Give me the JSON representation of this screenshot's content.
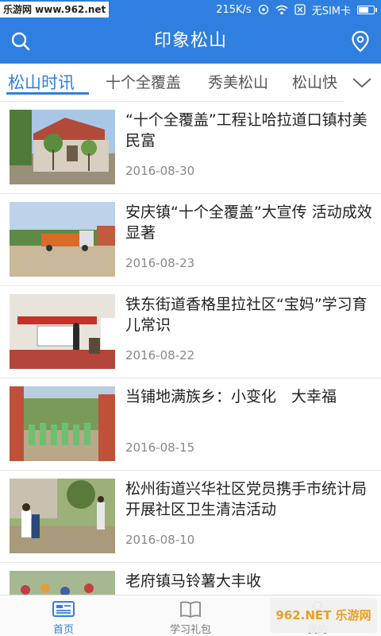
{
  "status_bar": {
    "watermark": "乐游网 www.962.net",
    "network_speed": "215K/s",
    "sim_status": "无SIM卡"
  },
  "header": {
    "title": "印象松山",
    "left_icon": "search-icon",
    "right_icon": "location-pin-icon"
  },
  "tabs": [
    {
      "label": "松山时讯",
      "active": true
    },
    {
      "label": "十个全覆盖",
      "active": false
    },
    {
      "label": "秀美松山",
      "active": false
    },
    {
      "label": "松山快",
      "active": false
    }
  ],
  "tab_more_icon": "chevron-down-icon",
  "news": [
    {
      "title": "“十个全覆盖”工程让哈拉道口镇村美民富",
      "date": "2016-08-30"
    },
    {
      "title": "安庆镇“十个全覆盖”大宣传 活动成效显著",
      "date": "2016-08-23"
    },
    {
      "title": "铁东街道香格里拉社区“宝妈”学习育儿常识",
      "date": "2016-08-22"
    },
    {
      "title": "当铺地满族乡：小变化　大幸福",
      "date": "2016-08-15"
    },
    {
      "title": "松州街道兴华社区党员携手市统计局开展社区卫生清洁活动",
      "date": "2016-08-10"
    },
    {
      "title": "老府镇马铃薯大丰收",
      "date": ""
    }
  ],
  "bottom_nav": [
    {
      "label": "首页",
      "icon": "news-home-icon",
      "active": true
    },
    {
      "label": "学习礼包",
      "icon": "book-icon",
      "active": false
    },
    {
      "label": "我的",
      "icon": "user-icon",
      "active": false
    }
  ],
  "corner_watermark": "962.NET 乐游网",
  "colors": {
    "accent": "#2f7fe0",
    "text": "#222222",
    "muted": "#888888"
  }
}
